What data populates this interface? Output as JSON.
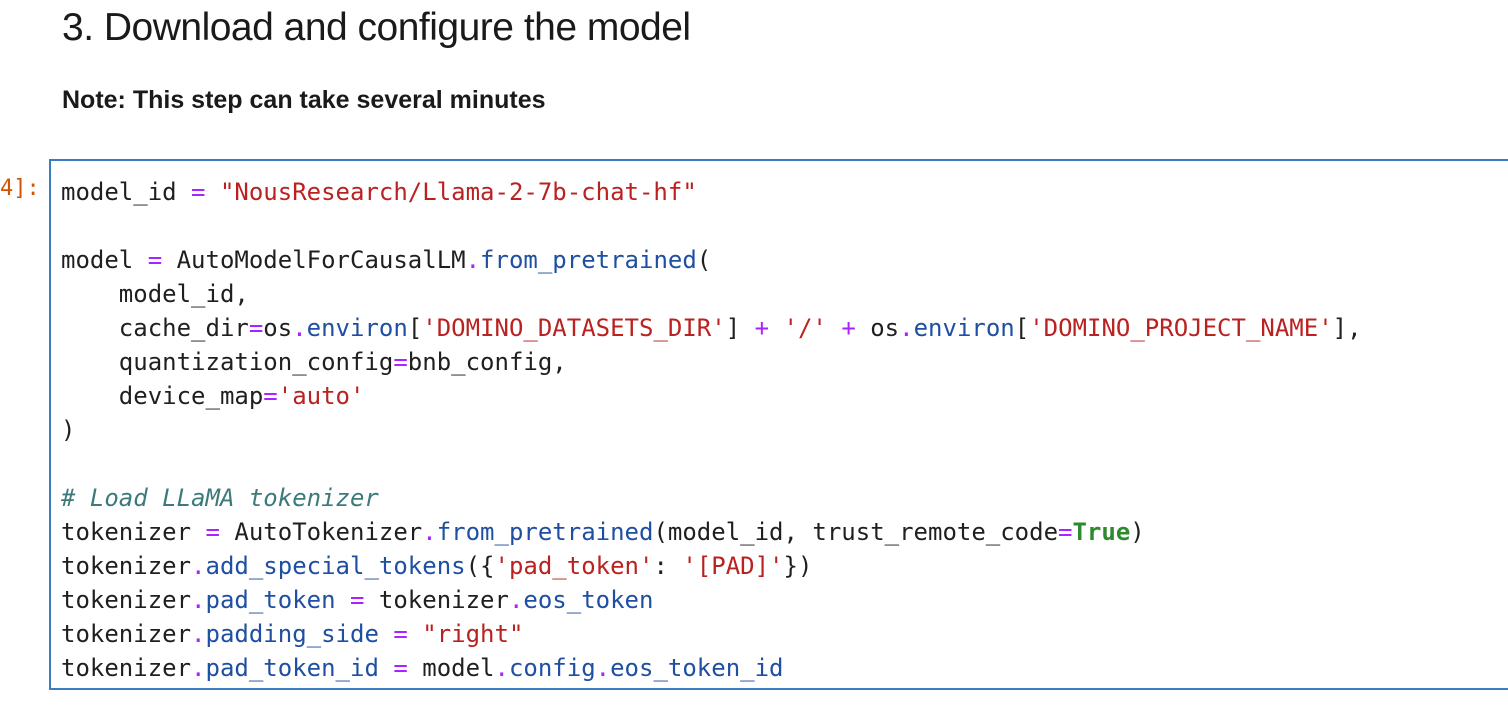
{
  "section": {
    "title": "3. Download and configure the model",
    "note": "Note: This step can take several minutes"
  },
  "cell": {
    "prompt": "4]:",
    "lines": [
      [
        {
          "t": "model_id ",
          "c": ""
        },
        {
          "t": "=",
          "c": "op"
        },
        {
          "t": " ",
          "c": ""
        },
        {
          "t": "\"NousResearch/Llama-2-7b-chat-hf\"",
          "c": "str"
        }
      ],
      [],
      [
        {
          "t": "model ",
          "c": ""
        },
        {
          "t": "=",
          "c": "op"
        },
        {
          "t": " AutoModelForCausalLM",
          "c": ""
        },
        {
          "t": ".",
          "c": "op"
        },
        {
          "t": "from_pretrained",
          "c": "attr"
        },
        {
          "t": "(",
          "c": ""
        }
      ],
      [
        {
          "t": "    model_id,",
          "c": ""
        }
      ],
      [
        {
          "t": "    cache_dir",
          "c": ""
        },
        {
          "t": "=",
          "c": "op"
        },
        {
          "t": "os",
          "c": ""
        },
        {
          "t": ".",
          "c": "op"
        },
        {
          "t": "environ",
          "c": "attr"
        },
        {
          "t": "[",
          "c": ""
        },
        {
          "t": "'DOMINO_DATASETS_DIR'",
          "c": "str"
        },
        {
          "t": "] ",
          "c": ""
        },
        {
          "t": "+",
          "c": "op"
        },
        {
          "t": " ",
          "c": ""
        },
        {
          "t": "'/'",
          "c": "str"
        },
        {
          "t": " ",
          "c": ""
        },
        {
          "t": "+",
          "c": "op"
        },
        {
          "t": " os",
          "c": ""
        },
        {
          "t": ".",
          "c": "op"
        },
        {
          "t": "environ",
          "c": "attr"
        },
        {
          "t": "[",
          "c": ""
        },
        {
          "t": "'DOMINO_PROJECT_NAME'",
          "c": "str"
        },
        {
          "t": "],",
          "c": ""
        }
      ],
      [
        {
          "t": "    quantization_config",
          "c": ""
        },
        {
          "t": "=",
          "c": "op"
        },
        {
          "t": "bnb_config,",
          "c": ""
        }
      ],
      [
        {
          "t": "    device_map",
          "c": ""
        },
        {
          "t": "=",
          "c": "op"
        },
        {
          "t": "'auto'",
          "c": "str"
        }
      ],
      [
        {
          "t": ")",
          "c": ""
        }
      ],
      [],
      [
        {
          "t": "# Load LLaMA tokenizer",
          "c": "cm"
        }
      ],
      [
        {
          "t": "tokenizer ",
          "c": ""
        },
        {
          "t": "=",
          "c": "op"
        },
        {
          "t": " AutoTokenizer",
          "c": ""
        },
        {
          "t": ".",
          "c": "op"
        },
        {
          "t": "from_pretrained",
          "c": "attr"
        },
        {
          "t": "(model_id, trust_remote_code",
          "c": ""
        },
        {
          "t": "=",
          "c": "op"
        },
        {
          "t": "True",
          "c": "kw"
        },
        {
          "t": ")",
          "c": ""
        }
      ],
      [
        {
          "t": "tokenizer",
          "c": ""
        },
        {
          "t": ".",
          "c": "op"
        },
        {
          "t": "add_special_tokens",
          "c": "attr"
        },
        {
          "t": "({",
          "c": ""
        },
        {
          "t": "'pad_token'",
          "c": "str"
        },
        {
          "t": ": ",
          "c": ""
        },
        {
          "t": "'[PAD]'",
          "c": "str"
        },
        {
          "t": "})",
          "c": ""
        }
      ],
      [
        {
          "t": "tokenizer",
          "c": ""
        },
        {
          "t": ".",
          "c": "op"
        },
        {
          "t": "pad_token",
          "c": "attr"
        },
        {
          "t": " ",
          "c": ""
        },
        {
          "t": "=",
          "c": "op"
        },
        {
          "t": " tokenizer",
          "c": ""
        },
        {
          "t": ".",
          "c": "op"
        },
        {
          "t": "eos_token",
          "c": "attr"
        }
      ],
      [
        {
          "t": "tokenizer",
          "c": ""
        },
        {
          "t": ".",
          "c": "op"
        },
        {
          "t": "padding_side",
          "c": "attr"
        },
        {
          "t": " ",
          "c": ""
        },
        {
          "t": "=",
          "c": "op"
        },
        {
          "t": " ",
          "c": ""
        },
        {
          "t": "\"right\"",
          "c": "str"
        }
      ],
      [
        {
          "t": "tokenizer",
          "c": ""
        },
        {
          "t": ".",
          "c": "op"
        },
        {
          "t": "pad_token_id",
          "c": "attr"
        },
        {
          "t": " ",
          "c": ""
        },
        {
          "t": "=",
          "c": "op"
        },
        {
          "t": " model",
          "c": ""
        },
        {
          "t": ".",
          "c": "op"
        },
        {
          "t": "config",
          "c": "attr"
        },
        {
          "t": ".",
          "c": "op"
        },
        {
          "t": "eos_token_id",
          "c": "attr"
        }
      ]
    ]
  },
  "colors": {
    "cell_border": "#3b7dc4",
    "prompt": "#d35400",
    "operator": "#aa22ff",
    "string": "#ba2121",
    "attribute": "#1f4fa3",
    "keyword": "#2d8a2d",
    "comment": "#3d7a7a"
  }
}
